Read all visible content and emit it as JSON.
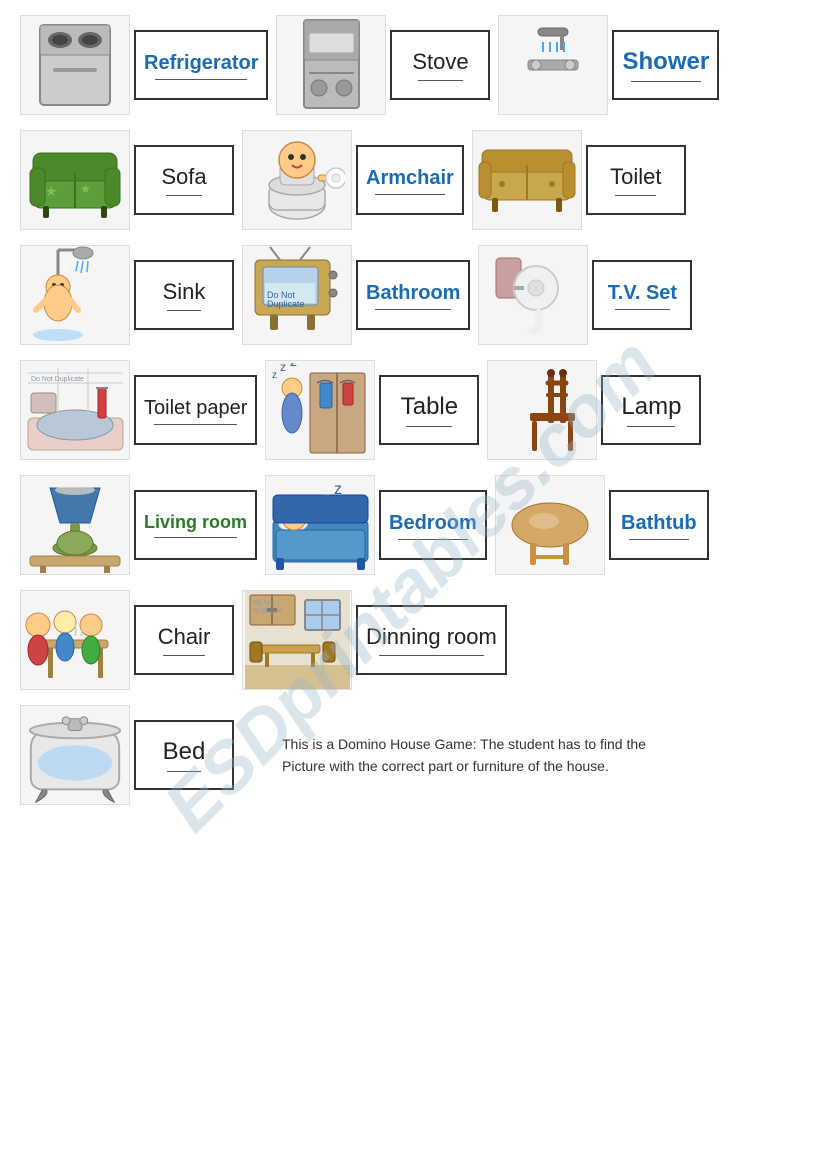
{
  "watermark": "ESDprintables.com",
  "rows": [
    {
      "id": "row1",
      "items": [
        {
          "id": "refrigerator",
          "label": "Refrigerator",
          "labelColor": "blue",
          "icon": "refrigerator"
        },
        {
          "id": "stove",
          "label": "Stove",
          "labelColor": "black",
          "icon": "stove"
        },
        {
          "id": "shower",
          "label": "Shower",
          "labelColor": "blue",
          "icon": "shower"
        }
      ]
    },
    {
      "id": "row2",
      "items": [
        {
          "id": "sofa",
          "label": "Sofa",
          "labelColor": "black",
          "icon": "sofa"
        },
        {
          "id": "armchair",
          "label": "Armchair",
          "labelColor": "blue",
          "icon": "armchair"
        },
        {
          "id": "toilet",
          "label": "Toilet",
          "labelColor": "black",
          "icon": "toilet"
        }
      ]
    },
    {
      "id": "row3",
      "items": [
        {
          "id": "sink",
          "label": "Sink",
          "labelColor": "black",
          "icon": "sink"
        },
        {
          "id": "bathroom",
          "label": "Bathroom",
          "labelColor": "blue",
          "icon": "bathroom"
        },
        {
          "id": "tvset",
          "label": "T.V. Set",
          "labelColor": "blue",
          "icon": "tvset"
        }
      ]
    },
    {
      "id": "row4",
      "items": [
        {
          "id": "toiletpaper",
          "label": "Toilet paper",
          "labelColor": "black",
          "icon": "toiletpaper"
        },
        {
          "id": "table",
          "label": "Table",
          "labelColor": "black",
          "icon": "table"
        },
        {
          "id": "lamp",
          "label": "Lamp",
          "labelColor": "black",
          "icon": "lamp"
        }
      ]
    },
    {
      "id": "row5",
      "items": [
        {
          "id": "livingroom",
          "label": "Living room",
          "labelColor": "green",
          "icon": "livingroom"
        },
        {
          "id": "bedroom",
          "label": "Bedroom",
          "labelColor": "blue",
          "icon": "bedroom"
        },
        {
          "id": "bathtub",
          "label": "Bathtub",
          "labelColor": "blue",
          "icon": "bathtub"
        }
      ]
    },
    {
      "id": "row6",
      "items": [
        {
          "id": "chair",
          "label": "Chair",
          "labelColor": "black",
          "icon": "chair"
        },
        {
          "id": "dinningroom",
          "label": "Dinning room",
          "labelColor": "black",
          "icon": "dinningroom"
        }
      ]
    },
    {
      "id": "row7",
      "items": [
        {
          "id": "bed",
          "label": "Bed",
          "labelColor": "black",
          "icon": "bed"
        }
      ]
    }
  ],
  "bottom_text_line1": "This is a Domino House Game: The student has to find the",
  "bottom_text_line2": "Picture with the correct part or furniture of the house."
}
